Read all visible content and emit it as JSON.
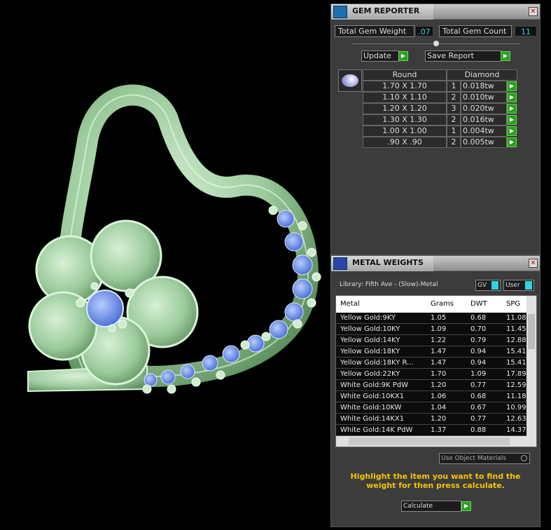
{
  "gem_reporter": {
    "title": "GEM REPORTER",
    "total_weight_label": "Total Gem Weight",
    "total_weight_value": ".07",
    "total_count_label": "Total Gem Count",
    "total_count_value": "11",
    "update_label": "Update",
    "save_label": "Save Report",
    "shape_header": "Round",
    "type_header": "Diamond",
    "rows": [
      {
        "size": "1.70 X 1.70",
        "qty": "1",
        "tw": "0.018tw"
      },
      {
        "size": "1.10 X 1.10",
        "qty": "2",
        "tw": "0.010tw"
      },
      {
        "size": "1.20 X 1.20",
        "qty": "3",
        "tw": "0.020tw"
      },
      {
        "size": "1.30 X 1.30",
        "qty": "2",
        "tw": "0.016tw"
      },
      {
        "size": "1.00 X 1.00",
        "qty": "1",
        "tw": "0.004tw"
      },
      {
        "size": ".90 X .90",
        "qty": "2",
        "tw": "0.005tw"
      }
    ]
  },
  "metal_weights": {
    "title": "METAL WEIGHTS",
    "library": "Library: Fifth Ave - (Slow)-Metal",
    "gv_label": "GV",
    "user_label": "User",
    "headers": [
      "Metal",
      "Grams",
      "DWT",
      "SPG"
    ],
    "rows": [
      [
        "Yellow Gold:9KY",
        "1.05",
        "0.68",
        "11.08"
      ],
      [
        "Yellow Gold:10KY",
        "1.09",
        "0.70",
        "11.45"
      ],
      [
        "Yellow Gold:14KY",
        "1.22",
        "0.79",
        "12.88"
      ],
      [
        "Yellow Gold:18KY",
        "1.47",
        "0.94",
        "15.41"
      ],
      [
        "Yellow Gold:18KY R...",
        "1.47",
        "0.94",
        "15.41"
      ],
      [
        "Yellow Gold:22KY",
        "1.70",
        "1.09",
        "17.89"
      ],
      [
        "White Gold:9K PdW",
        "1.20",
        "0.77",
        "12.59"
      ],
      [
        "White Gold:10KX1",
        "1.06",
        "0.68",
        "11.18"
      ],
      [
        "White Gold:10KW",
        "1.04",
        "0.67",
        "10.99"
      ],
      [
        "White Gold:14KX1",
        "1.20",
        "0.77",
        "12.63"
      ],
      [
        "White Gold:14K PdW",
        "1.37",
        "0.88",
        "14.37"
      ]
    ],
    "use_materials_label": "Use Object Materials",
    "instructions": "Highlight the item you want to find the weight for then press calculate.",
    "calculate_label": "Calculate"
  },
  "colors": {
    "accent_green": "#2b9f1f",
    "value_cyan": "#2fd4e0",
    "instruction_yellow": "#f5c400",
    "metal_green": "#a8d8a8",
    "gem_blue": "#6c8fe8"
  }
}
